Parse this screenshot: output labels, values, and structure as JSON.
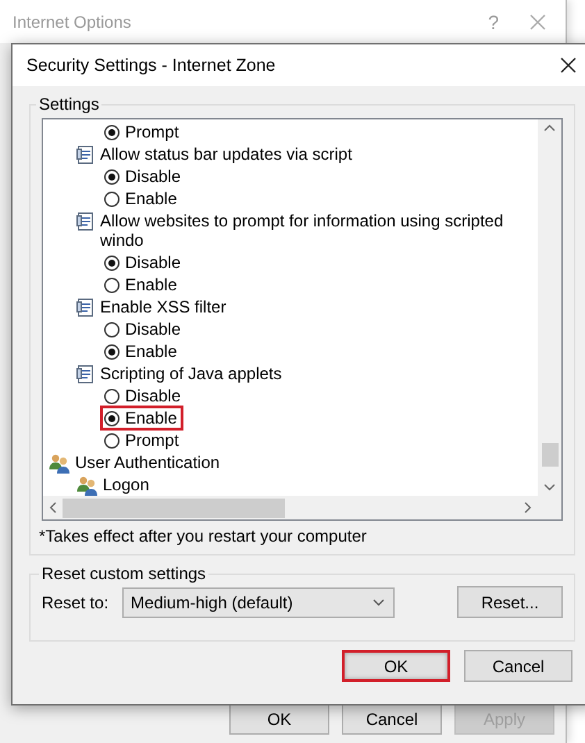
{
  "background_window": {
    "title": "Internet Options",
    "help_button": "?",
    "buttons": [
      {
        "label": "OK",
        "disabled": false
      },
      {
        "label": "Cancel",
        "disabled": false
      },
      {
        "label": "Apply",
        "disabled": true
      }
    ]
  },
  "dialog": {
    "title": "Security Settings - Internet Zone",
    "settings_group": {
      "legend": "Settings",
      "items": [
        {
          "kind": "option",
          "label": "Prompt",
          "selected": true,
          "highlighted": false
        },
        {
          "kind": "setting",
          "label": "Allow status bar updates via script",
          "children": [
            {
              "kind": "option",
              "label": "Disable",
              "selected": true,
              "highlighted": false
            },
            {
              "kind": "option",
              "label": "Enable",
              "selected": false,
              "highlighted": false
            }
          ]
        },
        {
          "kind": "setting",
          "label": "Allow websites to prompt for information using scripted windo",
          "children": [
            {
              "kind": "option",
              "label": "Disable",
              "selected": true,
              "highlighted": false
            },
            {
              "kind": "option",
              "label": "Enable",
              "selected": false,
              "highlighted": false
            }
          ]
        },
        {
          "kind": "setting",
          "label": "Enable XSS filter",
          "children": [
            {
              "kind": "option",
              "label": "Disable",
              "selected": false,
              "highlighted": false
            },
            {
              "kind": "option",
              "label": "Enable",
              "selected": true,
              "highlighted": false
            }
          ]
        },
        {
          "kind": "setting",
          "label": "Scripting of Java applets",
          "children": [
            {
              "kind": "option",
              "label": "Disable",
              "selected": false,
              "highlighted": false
            },
            {
              "kind": "option",
              "label": "Enable",
              "selected": true,
              "highlighted": true
            },
            {
              "kind": "option",
              "label": "Prompt",
              "selected": false,
              "highlighted": false
            }
          ]
        },
        {
          "kind": "group",
          "label": "User Authentication",
          "children": [
            {
              "kind": "subgroup",
              "label": "Logon"
            }
          ]
        }
      ],
      "footnote": "*Takes effect after you restart your computer"
    },
    "reset_group": {
      "legend": "Reset custom settings",
      "label": "Reset to:",
      "dropdown": {
        "value": "Medium-high (default)"
      },
      "button": "Reset..."
    },
    "buttons": [
      {
        "label": "OK",
        "highlighted": true
      },
      {
        "label": "Cancel",
        "highlighted": false
      }
    ]
  }
}
